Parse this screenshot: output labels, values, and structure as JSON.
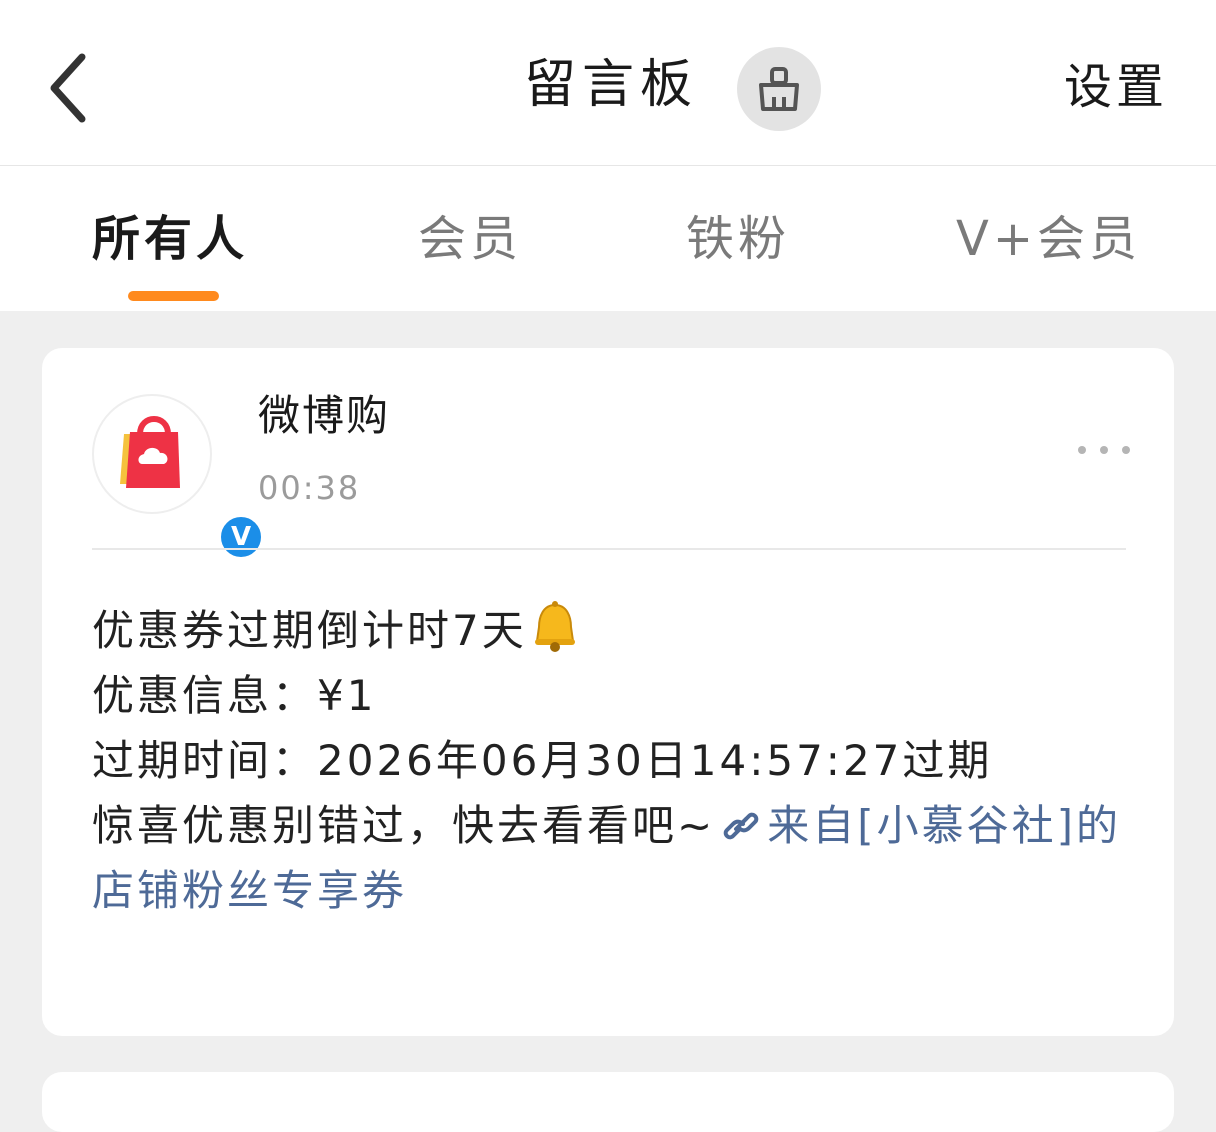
{
  "header": {
    "title": "留言板",
    "settings_label": "设置"
  },
  "tabs": [
    {
      "label": "所有人",
      "active": true
    },
    {
      "label": "会员",
      "active": false
    },
    {
      "label": "铁粉",
      "active": false
    },
    {
      "label": "V+会员",
      "active": false
    }
  ],
  "post": {
    "sender": "微博购",
    "time": "00:38",
    "verified_mark": "V",
    "lines": {
      "l1": "优惠券过期倒计时7天",
      "l2": "优惠信息：¥1",
      "l3": "过期时间：2026年06月30日14:57:27过期",
      "l4": "惊喜优惠别错过，快去看看吧~"
    },
    "link_text": "来自[小慕谷社]的店铺粉丝专享券"
  },
  "colors": {
    "accent_orange": "#ff8a1e",
    "link_blue": "#4e6a97",
    "verified_blue": "#1b8ee8",
    "background": "#efefef"
  }
}
